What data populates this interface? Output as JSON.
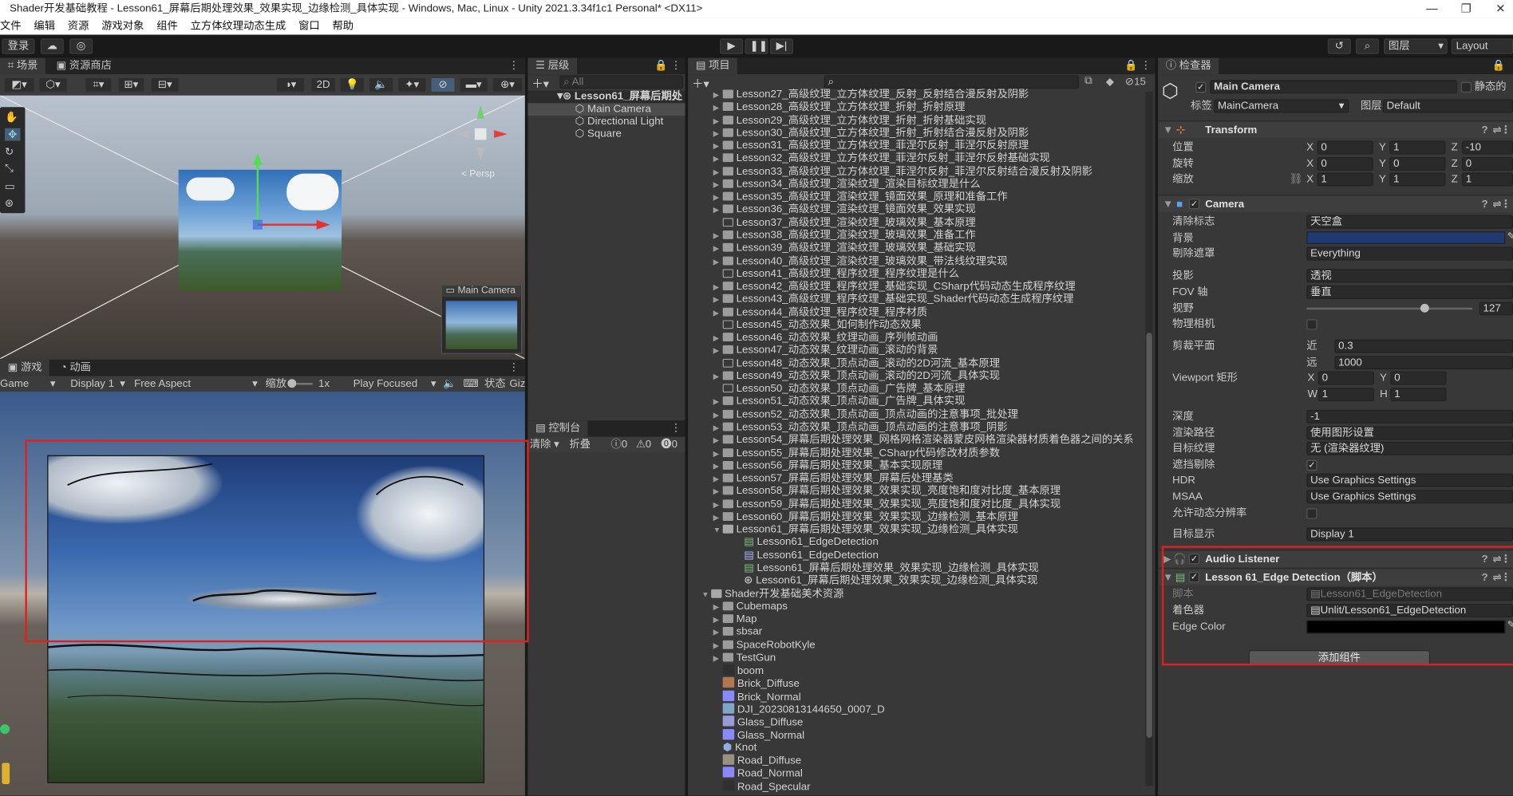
{
  "window": {
    "title": "Shader开发基础教程 - Lesson61_屏幕后期处理效果_效果实现_边缘检测_具体实现 - Windows, Mac, Linux - Unity 2021.3.34f1c1 Personal* <DX11>"
  },
  "menu": [
    "文件",
    "编辑",
    "资源",
    "游戏对象",
    "组件",
    "立方体纹理动态生成",
    "窗口",
    "帮助"
  ],
  "toolbar": {
    "login": "登录",
    "layers": "图层",
    "layout": "Layout"
  },
  "scene": {
    "tabs": [
      "场景",
      "资源商店"
    ],
    "mode2d": "2D",
    "persp": "< Persp",
    "camera_preview_title": "Main Camera"
  },
  "game": {
    "tabs": [
      "游戏",
      "动画"
    ],
    "game_dropdown": "Game",
    "display": "Display 1",
    "aspect": "Free Aspect",
    "scale_label": "缩放",
    "scale_value": "1x",
    "play_focused": "Play Focused",
    "stats": "状态",
    "gizmos": "Giz"
  },
  "hierarchy": {
    "tab": "层级",
    "search_placeholder": "All",
    "scene_name": "Lesson61_屏幕后期处",
    "items": [
      "Main Camera",
      "Directional Light",
      "Square"
    ]
  },
  "console": {
    "tab": "控制台",
    "clear": "清除",
    "collapse": "折叠",
    "count_log": "0",
    "count_warn": "0",
    "count_error": "0"
  },
  "project": {
    "tab": "项目",
    "hidden_count": "15",
    "items": [
      {
        "label": "Lesson27_高级纹理_立方体纹理_反射_反射结合漫反射及阴影",
        "type": "folder"
      },
      {
        "label": "Lesson28_高级纹理_立方体纹理_折射_折射原理",
        "type": "folder"
      },
      {
        "label": "Lesson29_高级纹理_立方体纹理_折射_折射基础实现",
        "type": "folder"
      },
      {
        "label": "Lesson30_高级纹理_立方体纹理_折射_折射结合漫反射及阴影",
        "type": "folder"
      },
      {
        "label": "Lesson31_高级纹理_立方体纹理_菲涅尔反射_菲涅尔反射原理",
        "type": "folder"
      },
      {
        "label": "Lesson32_高级纹理_立方体纹理_菲涅尔反射_菲涅尔反射基础实现",
        "type": "folder"
      },
      {
        "label": "Lesson33_高级纹理_立方体纹理_菲涅尔反射_菲涅尔反射结合漫反射及阴影",
        "type": "folder"
      },
      {
        "label": "Lesson34_高级纹理_渲染纹理_渲染目标纹理是什么",
        "type": "folder"
      },
      {
        "label": "Lesson35_高级纹理_渲染纹理_镜面效果_原理和准备工作",
        "type": "folder"
      },
      {
        "label": "Lesson36_高级纹理_渲染纹理_镜面效果_效果实现",
        "type": "folder"
      },
      {
        "label": "Lesson37_高级纹理_渲染纹理_玻璃效果_基本原理",
        "type": "folder-empty"
      },
      {
        "label": "Lesson38_高级纹理_渲染纹理_玻璃效果_准备工作",
        "type": "folder"
      },
      {
        "label": "Lesson39_高级纹理_渲染纹理_玻璃效果_基础实现",
        "type": "folder"
      },
      {
        "label": "Lesson40_高级纹理_渲染纹理_玻璃效果_带法线纹理实现",
        "type": "folder"
      },
      {
        "label": "Lesson41_高级纹理_程序纹理_程序纹理是什么",
        "type": "folder-empty"
      },
      {
        "label": "Lesson42_高级纹理_程序纹理_基础实现_CSharp代码动态生成程序纹理",
        "type": "folder"
      },
      {
        "label": "Lesson43_高级纹理_程序纹理_基础实现_Shader代码动态生成程序纹理",
        "type": "folder"
      },
      {
        "label": "Lesson44_高级纹理_程序纹理_程序材质",
        "type": "folder"
      },
      {
        "label": "Lesson45_动态效果_如何制作动态效果",
        "type": "folder-empty"
      },
      {
        "label": "Lesson46_动态效果_纹理动画_序列帧动画",
        "type": "folder"
      },
      {
        "label": "Lesson47_动态效果_纹理动画_滚动的背景",
        "type": "folder"
      },
      {
        "label": "Lesson48_动态效果_顶点动画_滚动的2D河流_基本原理",
        "type": "folder-empty"
      },
      {
        "label": "Lesson49_动态效果_顶点动画_滚动的2D河流_具体实现",
        "type": "folder"
      },
      {
        "label": "Lesson50_动态效果_顶点动画_广告牌_基本原理",
        "type": "folder-empty"
      },
      {
        "label": "Lesson51_动态效果_顶点动画_广告牌_具体实现",
        "type": "folder"
      },
      {
        "label": "Lesson52_动态效果_顶点动画_顶点动画的注意事项_批处理",
        "type": "folder"
      },
      {
        "label": "Lesson53_动态效果_顶点动画_顶点动画的注意事项_阴影",
        "type": "folder"
      },
      {
        "label": "Lesson54_屏幕后期处理效果_网格网格渲染器蒙皮网格渲染器材质着色器之间的关系",
        "type": "folder"
      },
      {
        "label": "Lesson55_屏幕后期处理效果_CSharp代码修改材质参数",
        "type": "folder"
      },
      {
        "label": "Lesson56_屏幕后期处理效果_基本实现原理",
        "type": "folder"
      },
      {
        "label": "Lesson57_屏幕后期处理效果_屏幕后处理基类",
        "type": "folder"
      },
      {
        "label": "Lesson58_屏幕后期处理效果_效果实现_亮度饱和度对比度_基本原理",
        "type": "folder"
      },
      {
        "label": "Lesson59_屏幕后期处理效果_效果实现_亮度饱和度对比度_具体实现",
        "type": "folder"
      },
      {
        "label": "Lesson60_屏幕后期处理效果_效果实现_边缘检测_基本原理",
        "type": "folder"
      },
      {
        "label": "Lesson61_屏幕后期处理效果_效果实现_边缘检测_具体实现",
        "type": "folder-open"
      },
      {
        "label": "Lesson61_EdgeDetection",
        "type": "script",
        "indent": 1
      },
      {
        "label": "Lesson61_EdgeDetection",
        "type": "shader",
        "indent": 1
      },
      {
        "label": "Lesson61_屏幕后期处理效果_效果实现_边缘检测_具体实现",
        "type": "script",
        "indent": 1
      },
      {
        "label": "Lesson61_屏幕后期处理效果_效果实现_边缘检测_具体实现",
        "type": "scene",
        "indent": 1
      },
      {
        "label": "Shader开发基础美术资源",
        "type": "folder-open",
        "indent": -1
      },
      {
        "label": "Cubemaps",
        "type": "folder"
      },
      {
        "label": "Map",
        "type": "folder"
      },
      {
        "label": "sbsar",
        "type": "folder"
      },
      {
        "label": "SpaceRobotKyle",
        "type": "folder"
      },
      {
        "label": "TestGun",
        "type": "folder"
      },
      {
        "label": "boom",
        "type": "tex-dark"
      },
      {
        "label": "Brick_Diffuse",
        "type": "tex-brick"
      },
      {
        "label": "Brick_Normal",
        "type": "tex-normal"
      },
      {
        "label": "DJI_20230813144650_0007_D",
        "type": "tex-photo"
      },
      {
        "label": "Glass_Diffuse",
        "type": "tex-glass"
      },
      {
        "label": "Glass_Normal",
        "type": "tex-normal"
      },
      {
        "label": "Knot",
        "type": "model"
      },
      {
        "label": "Road_Diffuse",
        "type": "tex-road"
      },
      {
        "label": "Road_Normal",
        "type": "tex-normal"
      },
      {
        "label": "Road_Specular",
        "type": "tex-dark"
      }
    ]
  },
  "inspector": {
    "tab": "检查器",
    "object_name": "Main Camera",
    "static_label": "静态的",
    "tag_label": "标签",
    "tag_value": "MainCamera",
    "layer_label": "图层",
    "layer_value": "Default",
    "transform": {
      "title": "Transform",
      "position_label": "位置",
      "position": [
        "0",
        "1",
        "-10"
      ],
      "rotation_label": "旋转",
      "rotation": [
        "0",
        "0",
        "0"
      ],
      "scale_label": "缩放",
      "scale": [
        "1",
        "1",
        "1"
      ],
      "axes": [
        "X",
        "Y",
        "Z"
      ]
    },
    "camera": {
      "title": "Camera",
      "clear_flags_label": "清除标志",
      "clear_flags": "天空盒",
      "background_label": "背景",
      "background_color": "#1f3a73",
      "culling_label": "剔除遮罩",
      "culling": "Everything",
      "projection_label": "投影",
      "projection": "透视",
      "fov_axis_label": "FOV 轴",
      "fov_axis": "垂直",
      "fov_label": "视野",
      "fov": "127",
      "physical_label": "物理相机",
      "clip_label": "剪裁平面",
      "near_label": "近",
      "near": "0.3",
      "far_label": "远",
      "far": "1000",
      "viewport_label": "Viewport 矩形",
      "vp_x": "0",
      "vp_y": "0",
      "vp_w": "1",
      "vp_h": "1",
      "depth_label": "深度",
      "depth": "-1",
      "render_path_label": "渲染路径",
      "render_path": "使用图形设置",
      "target_tex_label": "目标纹理",
      "target_tex": "无 (渲染器纹理)",
      "occlusion_label": "遮挡剔除",
      "hdr_label": "HDR",
      "hdr": "Use Graphics Settings",
      "msaa_label": "MSAA",
      "msaa": "Use Graphics Settings",
      "dyn_res_label": "允许动态分辨率",
      "target_display_label": "目标显示",
      "target_display": "Display 1"
    },
    "audio_listener": {
      "title": "Audio Listener"
    },
    "edge_detection": {
      "title": "Lesson 61_Edge Detection（脚本）",
      "script_label": "脚本",
      "script_value": "Lesson61_EdgeDetection",
      "shader_label": "着色器",
      "shader_value": "Unlit/Lesson61_EdgeDetection",
      "edge_color_label": "Edge Color",
      "edge_color": "#000000"
    },
    "add_component": "添加组件"
  },
  "colors": {
    "highlight_red": "#e02020",
    "panel": "#383838",
    "selection": "#4d4d4d"
  }
}
